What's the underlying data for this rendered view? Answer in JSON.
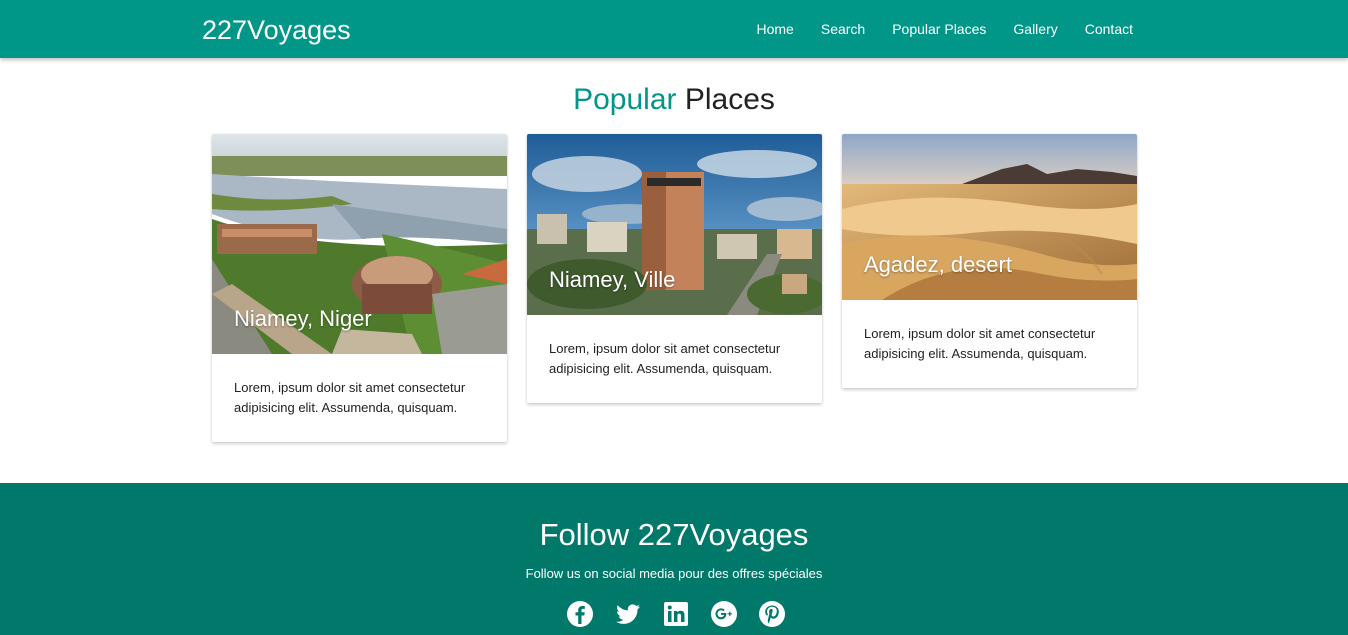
{
  "navbar": {
    "brand": "227Voyages",
    "links": [
      "Home",
      "Search",
      "Popular Places",
      "Gallery",
      "Contact"
    ]
  },
  "popular": {
    "title_accent": "Popular",
    "title_rest": "Places",
    "cards": [
      {
        "title": "Niamey, Niger",
        "text": "Lorem, ipsum dolor sit amet consectetur adipisicing elit. Assumenda, quisquam."
      },
      {
        "title": "Niamey, Ville",
        "text": "Lorem, ipsum dolor sit amet consectetur adipisicing elit. Assumenda, quisquam."
      },
      {
        "title": "Agadez, desert",
        "text": "Lorem, ipsum dolor sit amet consectetur adipisicing elit. Assumenda, quisquam."
      }
    ]
  },
  "footer": {
    "title": "Follow 227Voyages",
    "subtitle": "Follow us on social media pour des offres spéciales",
    "socials": [
      "facebook-icon",
      "twitter-icon",
      "linkedin-icon",
      "google-plus-icon",
      "pinterest-icon"
    ]
  },
  "colors": {
    "primary": "#009688",
    "footer": "#00796b"
  }
}
